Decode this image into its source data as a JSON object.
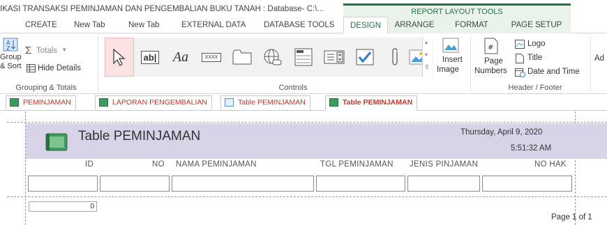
{
  "app": {
    "title": "IKASI TRANSAKSI PEMINJAMAN DAN PENGEMBALIAN BUKU TANAH : Database- C:\\...",
    "context_label": "REPORT LAYOUT TOOLS"
  },
  "tabs": [
    {
      "label": "CREATE"
    },
    {
      "label": "New Tab"
    },
    {
      "label": "New Tab"
    },
    {
      "label": "EXTERNAL DATA"
    },
    {
      "label": "DATABASE TOOLS"
    },
    {
      "label": "DESIGN"
    },
    {
      "label": "ARRANGE"
    },
    {
      "label": "FORMAT"
    },
    {
      "label": "PAGE SETUP"
    }
  ],
  "ribbon": {
    "grouping": {
      "group_line1": "Group",
      "group_line2": "& Sort",
      "totals": "Totals",
      "hide_details": "Hide Details",
      "label": "Grouping & Totals"
    },
    "controls": {
      "label": "Controls",
      "textbox_glyph": "ab|",
      "label_glyph": "Aa",
      "button_glyph": "XXXX",
      "insert_image_line1": "Insert",
      "insert_image_line2": "Image"
    },
    "header_footer": {
      "page_numbers_line1": "Page",
      "page_numbers_line2": "Numbers",
      "logo": "Logo",
      "title": "Title",
      "date_time": "Date and Time",
      "label": "Header / Footer",
      "more": "Ad"
    }
  },
  "doc_tabs": [
    {
      "label": "PEMINJAMAN"
    },
    {
      "label": "LAPORAN PENGEMBALIAN"
    },
    {
      "label": "Table PEMINJAMAN"
    },
    {
      "label": "Table PEMINJAMAN"
    }
  ],
  "report": {
    "title": "Table PEMINJAMAN",
    "date": "Thursday, April 9, 2020",
    "time": "5:51:32 AM",
    "columns": [
      "ID",
      "NO",
      "NAMA PEMINJAMAN",
      "TGL PEMINJAMAN",
      "JENIS PINJAMAN",
      "NO HAK"
    ],
    "count_value": "0",
    "page_text": "Page 1 of 1"
  },
  "colors": {
    "accent": "#217346",
    "header_band": "#d9d3e8",
    "doc_tab_text": "#c0392b"
  }
}
